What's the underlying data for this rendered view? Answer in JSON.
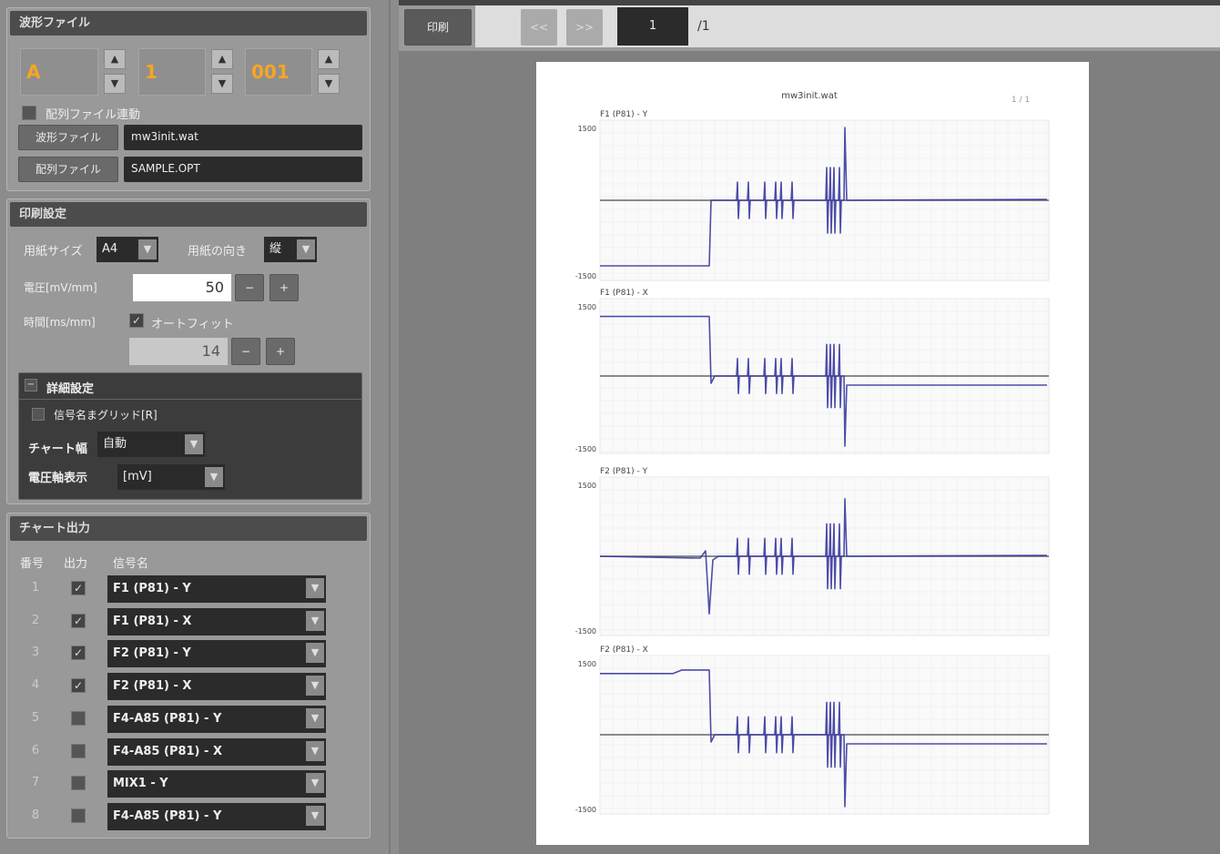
{
  "file_section": {
    "title": "波形ファイル",
    "code1": "A",
    "code2": "1",
    "code3": "001",
    "link_checkbox_label": "配列ファイル連動",
    "wave_file_button": "波形ファイル",
    "wave_file_value": "mw3init.wat",
    "array_file_button": "配列ファイル",
    "array_file_value": "SAMPLE.OPT"
  },
  "print_section": {
    "title": "印刷設定",
    "paper_size_label": "用紙サイズ",
    "paper_size_value": "A4",
    "orientation_label": "用紙の向き",
    "orientation_value": "縦",
    "voltage_label": "電圧[mV/mm]",
    "voltage_value": "50",
    "time_label": "時間[ms/mm]",
    "autofit_label": "オートフィット",
    "time_value": "14",
    "minus": "−",
    "plus": "+",
    "detail_title": "詳細設定",
    "grid_label": "信号名まグリッド[R]",
    "chart_width_label": "チャート幅",
    "chart_width_value": "自動",
    "voltage_axis_label": "電圧軸表示",
    "voltage_axis_value": "[mV]"
  },
  "chart_output": {
    "title": "チャート出力",
    "col_number": "番号",
    "col_output": "出力",
    "col_signal": "信号名",
    "rows": [
      {
        "num": "1",
        "checked": true,
        "signal": "F1 (P81) - Y"
      },
      {
        "num": "2",
        "checked": true,
        "signal": "F1 (P81) - X"
      },
      {
        "num": "3",
        "checked": true,
        "signal": "F2 (P81) - Y"
      },
      {
        "num": "4",
        "checked": true,
        "signal": "F2 (P81) - X"
      },
      {
        "num": "5",
        "checked": false,
        "signal": "F4-A85 (P81) - Y"
      },
      {
        "num": "6",
        "checked": false,
        "signal": "F4-A85 (P81) - X"
      },
      {
        "num": "7",
        "checked": false,
        "signal": "MIX1 - Y"
      },
      {
        "num": "8",
        "checked": false,
        "signal": "F4-A85 (P81) - Y"
      }
    ]
  },
  "toolbar": {
    "print_button": "印刷",
    "prev_button": "<<",
    "next_button": ">>",
    "page_current": "1",
    "page_total": "/1"
  },
  "preview": {
    "doc_title": "mw3init.wat",
    "page_indicator": "1 / 1",
    "charts": [
      {
        "label": "F1 (P81) - Y",
        "ymax": "1500",
        "ymin": "-1500"
      },
      {
        "label": "F1 (P81) - X",
        "ymax": "1500",
        "ymin": "-1500"
      },
      {
        "label": "F2 (P81) - Y",
        "ymax": "1500",
        "ymin": "-1500"
      },
      {
        "label": "F2 (P81) - X",
        "ymax": "1500",
        "ymin": "-1500"
      }
    ]
  },
  "colors": {
    "accent_orange": "#f5a623",
    "wave_blue": "#3a3aa0"
  }
}
